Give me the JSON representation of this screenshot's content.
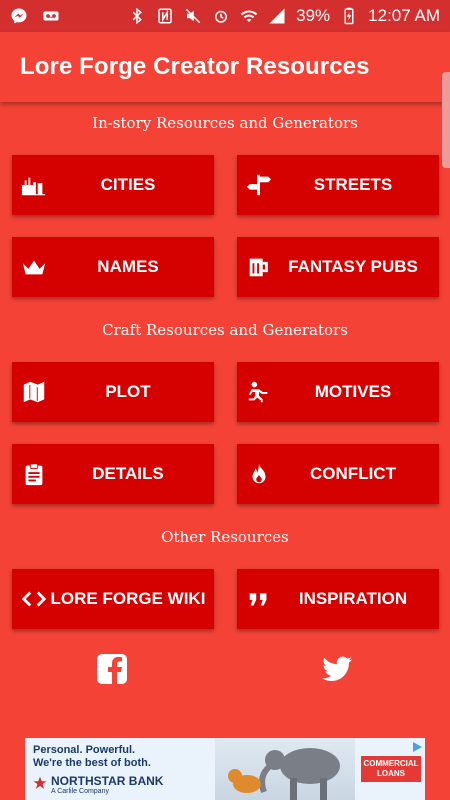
{
  "status_bar": {
    "battery": "39%",
    "time": "12:07 AM"
  },
  "app": {
    "title": "Lore Forge Creator Resources"
  },
  "sections": [
    {
      "title": "In-story Resources and Generators",
      "items": [
        {
          "label": "CITIES",
          "icon": "city-skyline-icon"
        },
        {
          "label": "STREETS",
          "icon": "signpost-icon"
        },
        {
          "label": "NAMES",
          "icon": "crown-icon"
        },
        {
          "label": "FANTASY PUBS",
          "icon": "beer-mug-icon"
        }
      ]
    },
    {
      "title": "Craft Resources and Generators",
      "items": [
        {
          "label": "PLOT",
          "icon": "map-icon"
        },
        {
          "label": "MOTIVES",
          "icon": "running-figure-icon"
        },
        {
          "label": "DETAILS",
          "icon": "clipboard-icon"
        },
        {
          "label": "CONFLICT",
          "icon": "flame-icon"
        }
      ]
    },
    {
      "title": "Other Resources",
      "items": [
        {
          "label": "LORE FORGE WIKI",
          "icon": "code-brackets-icon"
        },
        {
          "label": "INSPIRATION",
          "icon": "quote-icon"
        }
      ]
    }
  ],
  "social": {
    "facebook": "facebook-icon",
    "twitter": "twitter-icon"
  },
  "ad": {
    "headline_1": "Personal. Powerful.",
    "headline_2": "We're the best of both.",
    "brand": "NORTHSTAR BANK",
    "brand_sub": "A Carlile Company",
    "cta": "COMMERCIAL LOANS"
  },
  "colors": {
    "background": "#f44336",
    "status_bar": "#d32f2f",
    "tile": "#d50000",
    "text": "#ffffff"
  }
}
